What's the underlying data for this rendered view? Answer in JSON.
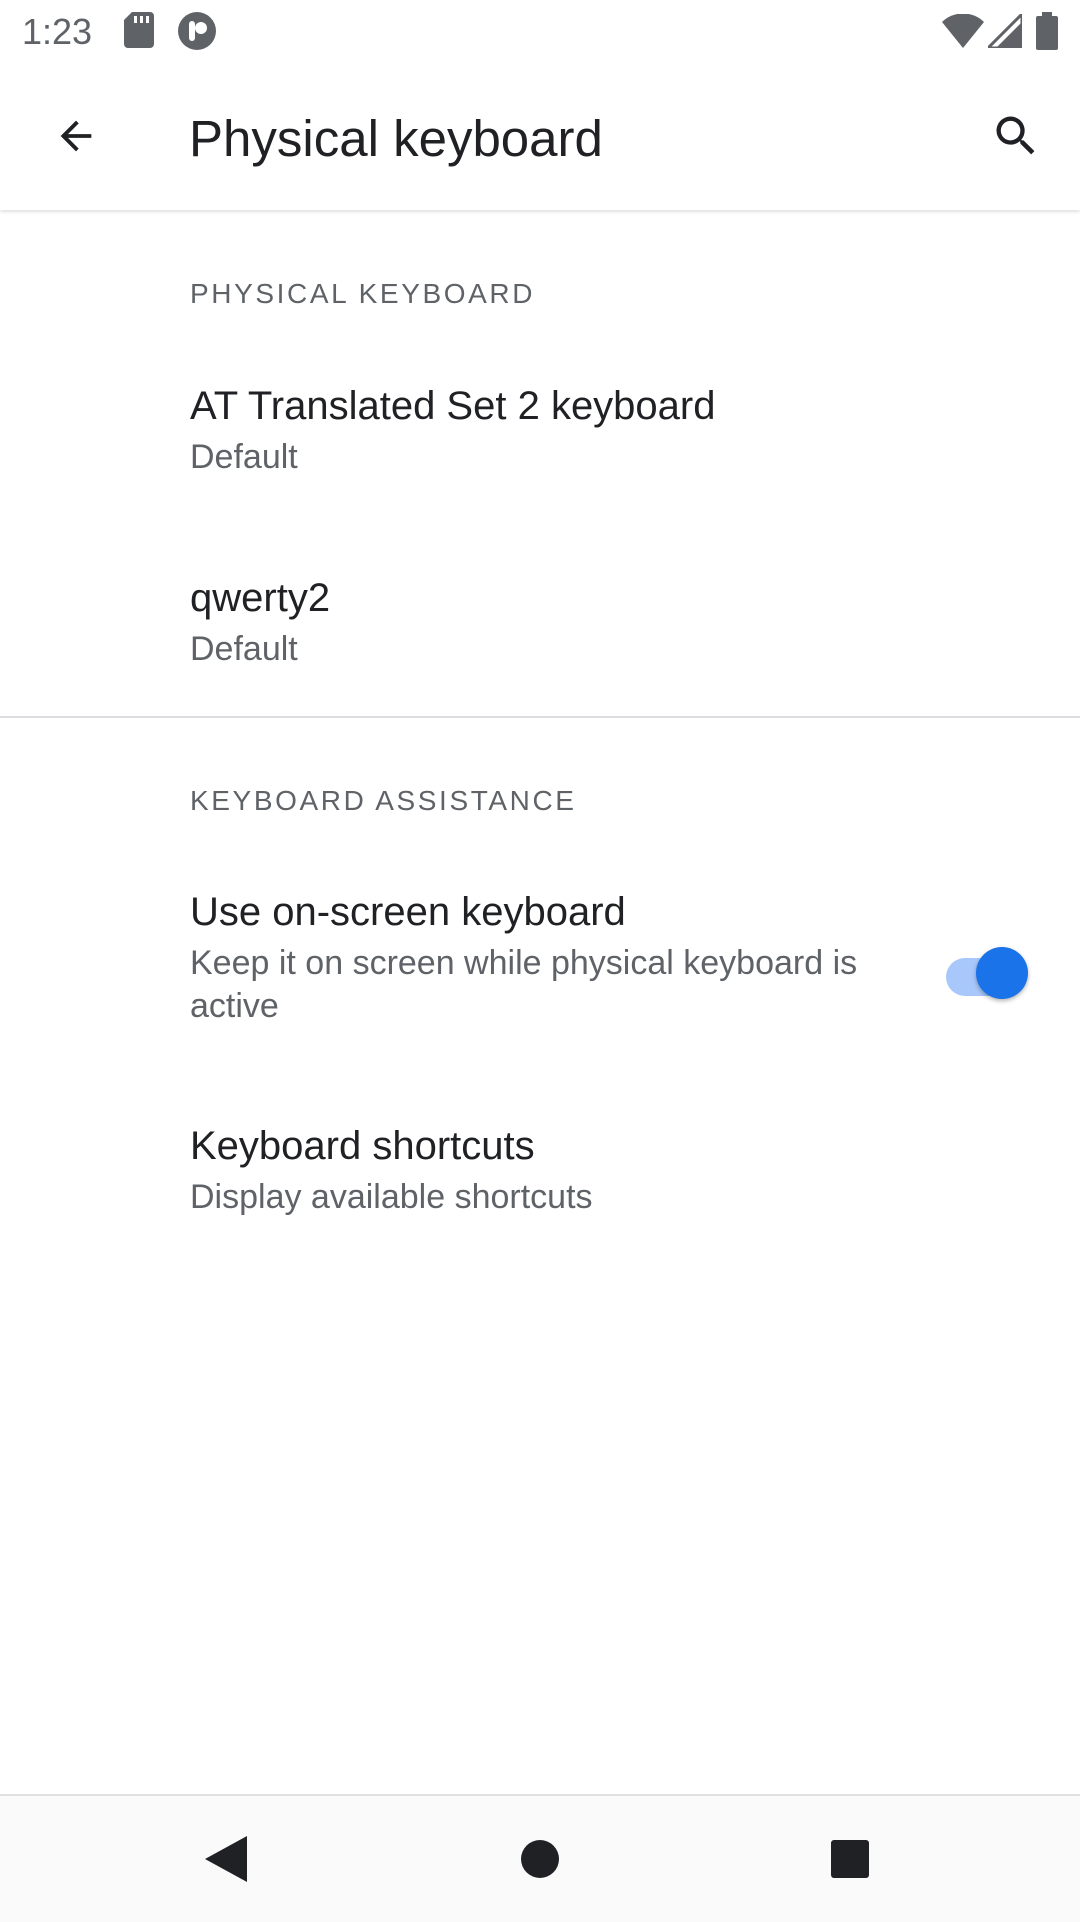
{
  "status_bar": {
    "time": "1:23",
    "icons": [
      "sd-card-icon",
      "notification-icon",
      "wifi-icon",
      "signal-icon",
      "battery-icon"
    ]
  },
  "app_bar": {
    "title": "Physical keyboard",
    "back_icon": "arrow-back-icon",
    "search_icon": "search-icon"
  },
  "sections": [
    {
      "header": "PHYSICAL KEYBOARD",
      "items": [
        {
          "title": "AT Translated Set 2 keyboard",
          "summary": "Default"
        },
        {
          "title": "qwerty2",
          "summary": "Default"
        }
      ]
    },
    {
      "header": "KEYBOARD ASSISTANCE",
      "items": [
        {
          "title": "Use on-screen keyboard",
          "summary": "Keep it on screen while physical keyboard is active",
          "toggle": true
        },
        {
          "title": "Keyboard shortcuts",
          "summary": "Display available shortcuts"
        }
      ]
    }
  ],
  "nav_bar": {
    "buttons": [
      "back-triangle-icon",
      "home-circle-icon",
      "recents-square-icon"
    ]
  },
  "colors": {
    "accent": "#1a73e8",
    "accent_track": "#a8c7fa",
    "text_primary": "#202124",
    "text_secondary": "#5f6368",
    "divider": "#dadce0"
  }
}
